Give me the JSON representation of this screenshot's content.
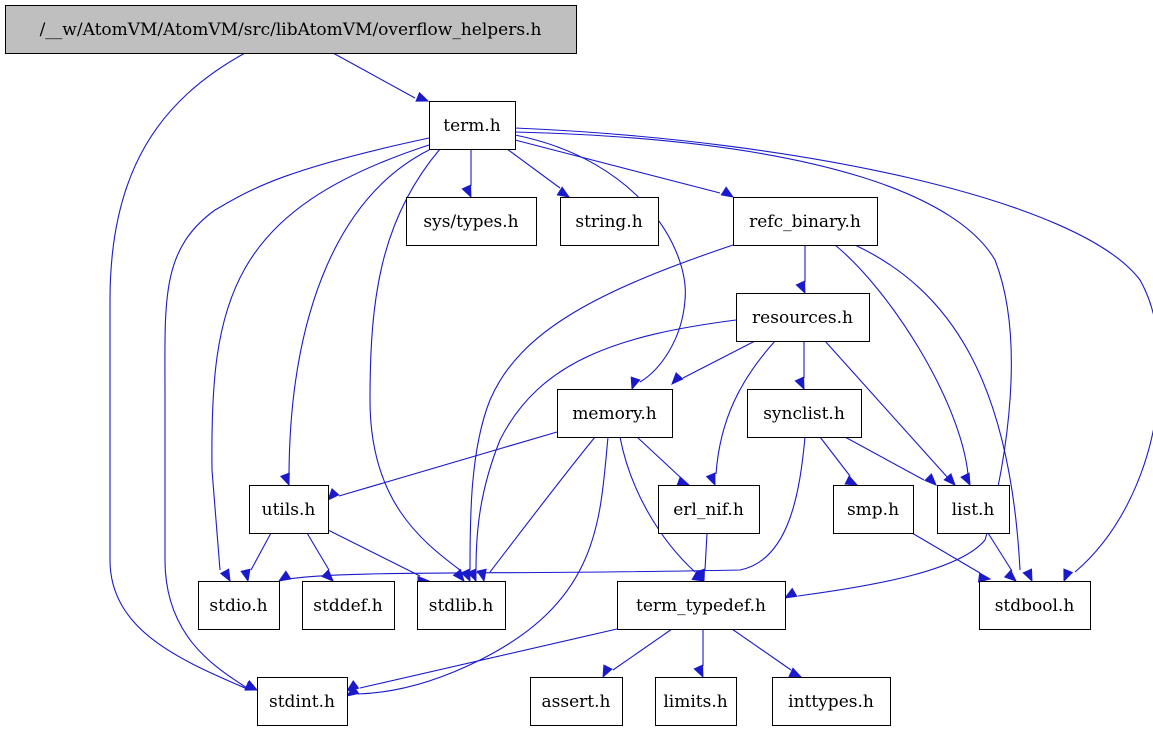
{
  "diagram": {
    "type": "include-dependency-graph",
    "edge_color": "#1a1acc",
    "root_fill": "#bfbfbf",
    "nodes": [
      {
        "id": "overflow_helpers",
        "label": "/__w/AtomVM/AtomVM/src/libAtomVM/overflow_helpers.h",
        "root": true
      },
      {
        "id": "term",
        "label": "term.h"
      },
      {
        "id": "sys_types",
        "label": "sys/types.h"
      },
      {
        "id": "string",
        "label": "string.h"
      },
      {
        "id": "refc_binary",
        "label": "refc_binary.h"
      },
      {
        "id": "resources",
        "label": "resources.h"
      },
      {
        "id": "memory",
        "label": "memory.h"
      },
      {
        "id": "synclist",
        "label": "synclist.h"
      },
      {
        "id": "utils",
        "label": "utils.h"
      },
      {
        "id": "erl_nif",
        "label": "erl_nif.h"
      },
      {
        "id": "smp",
        "label": "smp.h"
      },
      {
        "id": "list",
        "label": "list.h"
      },
      {
        "id": "stdio",
        "label": "stdio.h"
      },
      {
        "id": "stddef",
        "label": "stddef.h"
      },
      {
        "id": "stdlib",
        "label": "stdlib.h"
      },
      {
        "id": "term_typedef",
        "label": "term_typedef.h"
      },
      {
        "id": "stdbool",
        "label": "stdbool.h"
      },
      {
        "id": "stdint",
        "label": "stdint.h"
      },
      {
        "id": "assert",
        "label": "assert.h"
      },
      {
        "id": "limits",
        "label": "limits.h"
      },
      {
        "id": "inttypes",
        "label": "inttypes.h"
      }
    ],
    "edges": [
      [
        "overflow_helpers",
        "term"
      ],
      [
        "overflow_helpers",
        "stdint"
      ],
      [
        "term",
        "sys_types"
      ],
      [
        "term",
        "string"
      ],
      [
        "term",
        "refc_binary"
      ],
      [
        "term",
        "memory"
      ],
      [
        "term",
        "utils"
      ],
      [
        "term",
        "stdio"
      ],
      [
        "term",
        "stdlib"
      ],
      [
        "term",
        "stdint"
      ],
      [
        "term",
        "term_typedef"
      ],
      [
        "term",
        "stdbool"
      ],
      [
        "refc_binary",
        "resources"
      ],
      [
        "refc_binary",
        "stdlib"
      ],
      [
        "refc_binary",
        "list"
      ],
      [
        "refc_binary",
        "stdbool"
      ],
      [
        "resources",
        "memory"
      ],
      [
        "resources",
        "synclist"
      ],
      [
        "resources",
        "erl_nif"
      ],
      [
        "resources",
        "list"
      ],
      [
        "resources",
        "stdlib"
      ],
      [
        "memory",
        "utils"
      ],
      [
        "memory",
        "erl_nif"
      ],
      [
        "memory",
        "stdlib"
      ],
      [
        "memory",
        "term_typedef"
      ],
      [
        "memory",
        "stdint"
      ],
      [
        "synclist",
        "smp"
      ],
      [
        "synclist",
        "list"
      ],
      [
        "synclist",
        "stdio"
      ],
      [
        "utils",
        "stdio"
      ],
      [
        "utils",
        "stddef"
      ],
      [
        "utils",
        "stdlib"
      ],
      [
        "erl_nif",
        "term_typedef"
      ],
      [
        "smp",
        "stdbool"
      ],
      [
        "list",
        "stdbool"
      ],
      [
        "term_typedef",
        "stdint"
      ],
      [
        "term_typedef",
        "assert"
      ],
      [
        "term_typedef",
        "limits"
      ],
      [
        "term_typedef",
        "inttypes"
      ]
    ]
  }
}
